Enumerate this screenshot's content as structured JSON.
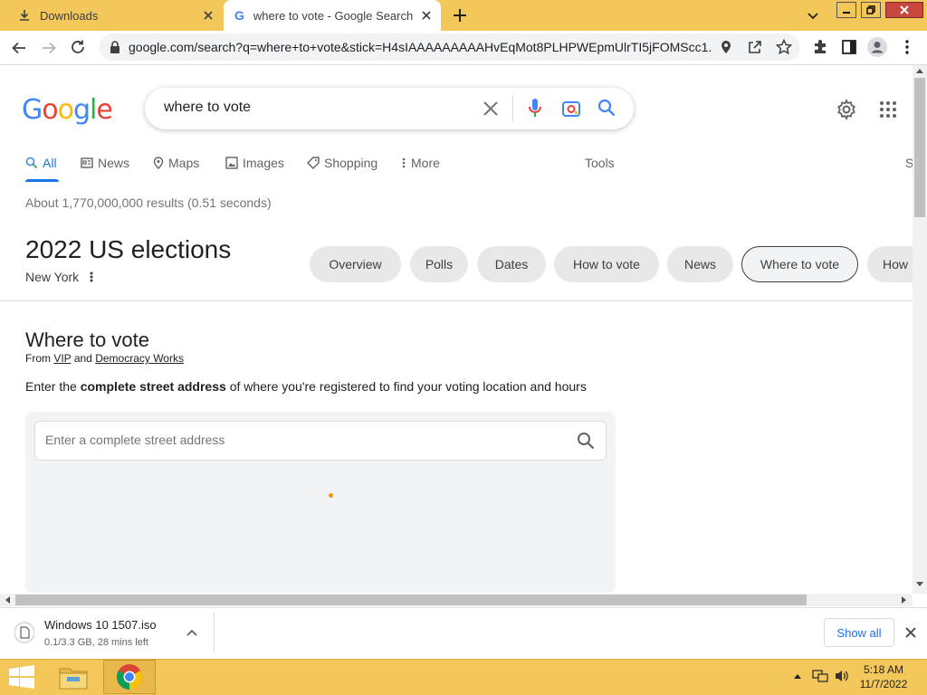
{
  "browser": {
    "tabs": [
      {
        "label": "Downloads"
      },
      {
        "label": "where to vote - Google Search"
      }
    ],
    "url": "google.com/search?q=where+to+vote&stick=H4sIAAAAAAAAAHvEqMot8PLHPWEpmUlrTI5jFOMScc1..."
  },
  "google": {
    "query": "where to vote",
    "nav": {
      "all": "All",
      "news": "News",
      "maps": "Maps",
      "images": "Images",
      "shopping": "Shopping",
      "more": "More",
      "tools": "Tools",
      "cut": "S"
    },
    "stats": "About 1,770,000,000 results (0.51 seconds)"
  },
  "elections": {
    "title": "2022 US elections",
    "location": "New York",
    "chips": [
      "Overview",
      "Polls",
      "Dates",
      "How to vote",
      "News",
      "Where to vote",
      "How"
    ]
  },
  "where_to_vote": {
    "title": "Where to vote",
    "from_prefix": "From",
    "source1": "VIP",
    "and": "and",
    "source2": "Democracy Works",
    "instr_pre": "Enter the",
    "instr_bold": "complete street address",
    "instr_post": "of where you're registered to find your voting location and hours",
    "placeholder": "Enter a complete street address"
  },
  "download": {
    "filename": "Windows 10 1507.iso",
    "status": "0.1/3.3 GB, 28 mins left",
    "show_all": "Show all"
  },
  "taskbar": {
    "time": "5:18 AM",
    "date": "11/7/2022"
  },
  "colors": {
    "accent": "#1a73e8",
    "tabbar": "#f3c75a",
    "close": "#c7463d"
  }
}
